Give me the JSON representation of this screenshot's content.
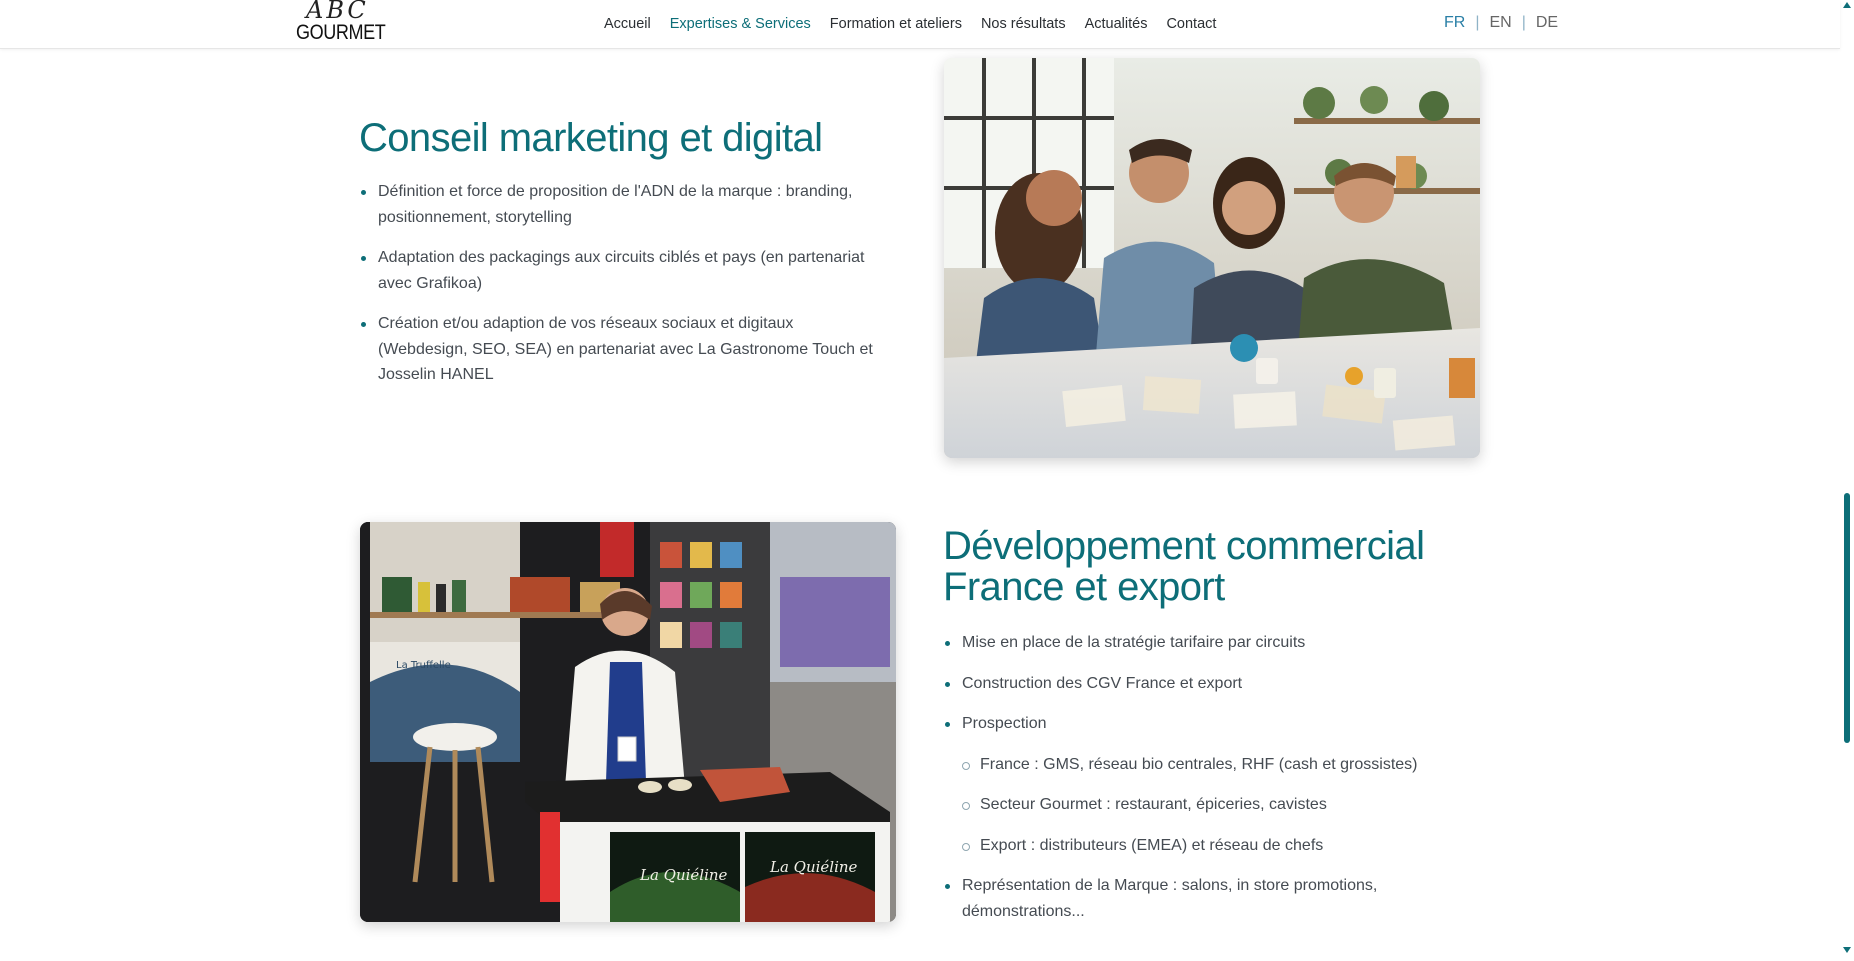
{
  "header": {
    "logo_script": "ABC",
    "logo_word": "GOURMET",
    "nav": [
      {
        "label": "Accueil",
        "active": false
      },
      {
        "label": "Expertises & Services",
        "active": true
      },
      {
        "label": "Formation et ateliers",
        "active": false
      },
      {
        "label": "Nos résultats",
        "active": false
      },
      {
        "label": "Actualités",
        "active": false
      },
      {
        "label": "Contact",
        "active": false
      }
    ],
    "languages": [
      {
        "code": "FR",
        "active": true
      },
      {
        "code": "EN",
        "active": false
      },
      {
        "code": "DE",
        "active": false
      }
    ]
  },
  "sections": {
    "marketing": {
      "title": "Conseil marketing et digital",
      "items": [
        "Définition et force de proposition de l'ADN de la marque : branding, positionnement, storytelling",
        "Adaptation des packagings aux circuits ciblés et pays (en partenariat avec Grafikoa)",
        "Création et/ou adaption de vos réseaux sociaux et digitaux (Webdesign, SEO, SEA) en partenariat avec La Gastronome Touch et Josselin HANEL"
      ]
    },
    "commercial": {
      "title_line1": "Développement commercial",
      "title_line2": "France et export",
      "items": [
        "Mise en place de la stratégie tarifaire par circuits",
        "Construction des CGV France et export",
        "Prospection"
      ],
      "sub_items": [
        "France : GMS, réseau bio centrales, RHF (cash et grossistes)",
        "Secteur Gourmet : restaurant, épiceries, cavistes",
        "Export : distributeurs (EMEA) et réseau de chefs"
      ],
      "last_item": "Représentation de la Marque : salons, in store promotions, démonstrations..."
    }
  },
  "images": {
    "team_photo_sign": "",
    "booth_sign_1": "La Truffelle",
    "booth_sign_2": "La Quiéline",
    "booth_sign_3": "La Quiéline"
  },
  "colors": {
    "accent": "#0d6e78",
    "lang_active": "#2a7fa6",
    "text": "#454b52"
  }
}
